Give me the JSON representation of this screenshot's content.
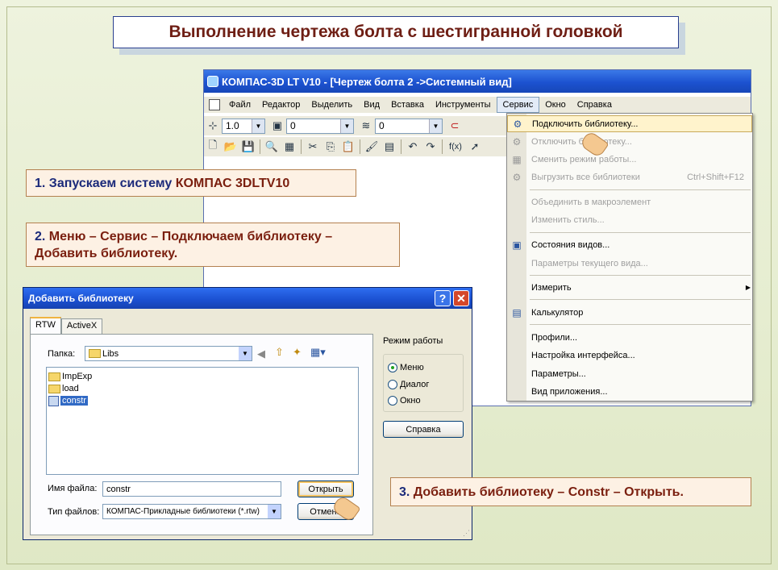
{
  "slide_title": "Выполнение чертежа болта с шестигранной головкой",
  "kompas": {
    "title": "КОМПАС-3D LT V10 - [Чертеж болта 2 ->Системный вид]",
    "menu": [
      "Файл",
      "Редактор",
      "Выделить",
      "Вид",
      "Вставка",
      "Инструменты",
      "Сервис",
      "Окно",
      "Справка"
    ],
    "toolbar": {
      "scale_value": "1.0",
      "layer_value": "0",
      "style_value": "0",
      "fx_label": "f(x)"
    },
    "service_menu": [
      {
        "label": "Подключить библиотеку...",
        "icon": "library-connect-icon",
        "state": "highlighted",
        "shortcut": ""
      },
      {
        "label": "Отключить библиотеку...",
        "icon": "library-disconnect-icon",
        "state": "disabled",
        "shortcut": ""
      },
      {
        "label": "Сменить режим работы...",
        "icon": "switch-mode-icon",
        "state": "disabled",
        "shortcut": ""
      },
      {
        "label": "Выгрузить все библиотеки",
        "icon": "unload-libraries-icon",
        "state": "disabled",
        "shortcut": "Ctrl+Shift+F12"
      },
      {
        "label": "Объединить в макроэлемент",
        "icon": "",
        "state": "disabled",
        "shortcut": ""
      },
      {
        "label": "Изменить стиль...",
        "icon": "",
        "state": "disabled",
        "shortcut": ""
      },
      {
        "label": "Состояния видов...",
        "icon": "view-states-icon",
        "state": "enabled",
        "shortcut": ""
      },
      {
        "label": "Параметры текущего вида...",
        "icon": "",
        "state": "disabled",
        "shortcut": ""
      },
      {
        "label": "Измерить",
        "icon": "",
        "state": "enabled",
        "shortcut": ""
      },
      {
        "label": "Калькулятор",
        "icon": "calculator-icon",
        "state": "enabled",
        "shortcut": ""
      },
      {
        "label": "Профили...",
        "icon": "",
        "state": "enabled",
        "shortcut": ""
      },
      {
        "label": "Настройка интерфейса...",
        "icon": "",
        "state": "enabled",
        "shortcut": ""
      },
      {
        "label": "Параметры...",
        "icon": "",
        "state": "enabled",
        "shortcut": ""
      },
      {
        "label": "Вид приложения...",
        "icon": "",
        "state": "enabled",
        "shortcut": ""
      }
    ]
  },
  "callouts": {
    "step1_prefix": "1. Запускаем систему ",
    "step1_highlight": "КОМПАС 3DLTV10",
    "step2_prefix": "2. ",
    "step2_highlight": "Меню – Сервис – Подключаем библиотеку – Добавить библиотеку.",
    "step3_prefix": "3. ",
    "step3_highlight": "Добавить библиотеку – Constr – Открыть."
  },
  "dialog": {
    "title": "Добавить библиотеку",
    "help_button": "?",
    "close_button": "✕",
    "tabs": [
      "RTW",
      "ActiveX"
    ],
    "folder_label": "Папка:",
    "folder_value": "Libs",
    "files": [
      {
        "name": "ImpExp",
        "type": "folder"
      },
      {
        "name": "load",
        "type": "folder"
      },
      {
        "name": "constr",
        "type": "library"
      }
    ],
    "filename_label": "Имя файла:",
    "filename_value": "constr",
    "filetype_label": "Тип файлов:",
    "filetype_value": "КОМПАС-Прикладные библиотеки (*.rtw)",
    "open_button": "Открыть",
    "cancel_button": "Отмена",
    "mode_label": "Режим работы",
    "modes": [
      "Меню",
      "Диалог",
      "Окно"
    ],
    "selected_mode": "Меню",
    "help_label": "Справка"
  }
}
